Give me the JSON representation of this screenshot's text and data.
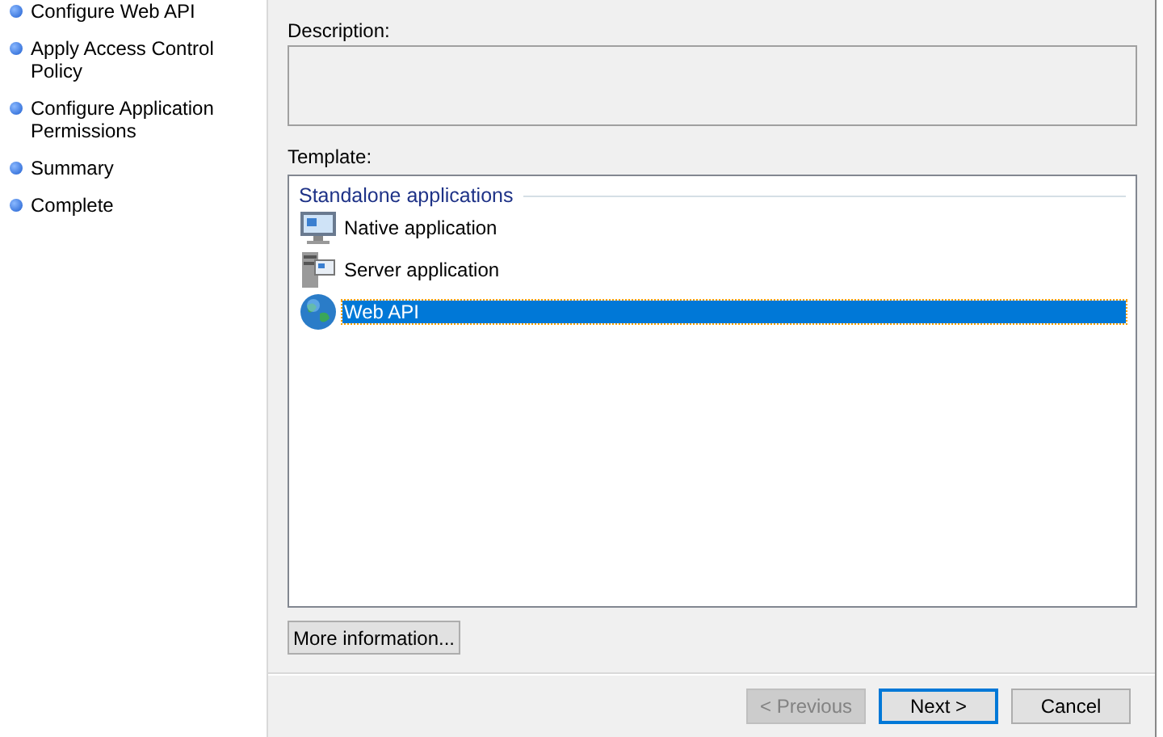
{
  "sidebar": {
    "steps": [
      {
        "label": "Configure Web API"
      },
      {
        "label": "Apply Access Control Policy"
      },
      {
        "label": "Configure Application Permissions"
      },
      {
        "label": "Summary"
      },
      {
        "label": "Complete"
      }
    ]
  },
  "description": {
    "label": "Description:"
  },
  "template": {
    "label": "Template:",
    "group": "Standalone applications",
    "items": [
      {
        "label": "Native application",
        "kind": "native",
        "selected": false
      },
      {
        "label": "Server application",
        "kind": "server",
        "selected": false
      },
      {
        "label": "Web API",
        "kind": "web",
        "selected": true
      }
    ]
  },
  "more_button": "More information...",
  "buttons": [
    {
      "label": "< Previous",
      "disabled": true,
      "default": false
    },
    {
      "label": "Next >",
      "disabled": false,
      "default": true
    },
    {
      "label": "Cancel",
      "disabled": false,
      "default": false
    }
  ]
}
